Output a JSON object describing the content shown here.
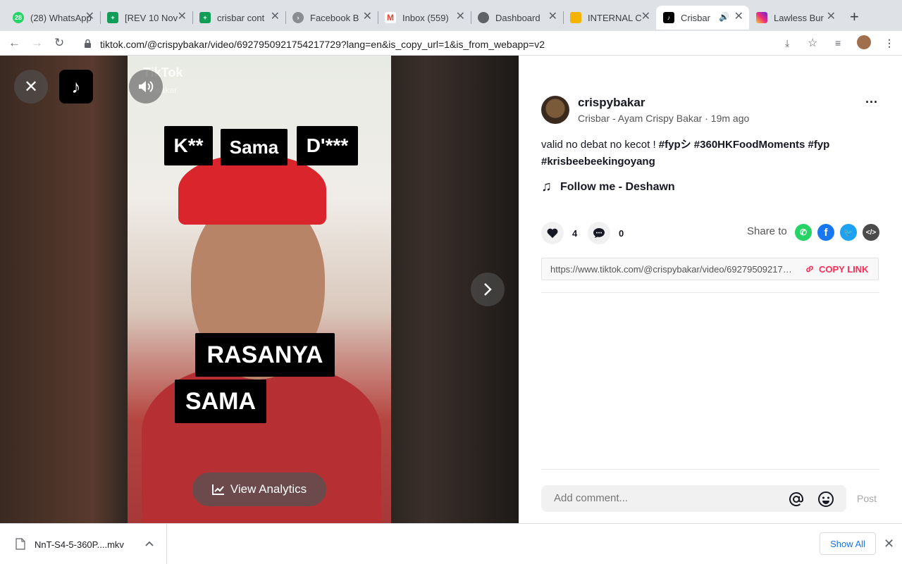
{
  "browser": {
    "tabs": [
      {
        "title": "(28) WhatsApp",
        "fav_color": "#25d366",
        "fav_text": "28",
        "icon": "whatsapp-icon"
      },
      {
        "title": "[REV 10 Nov",
        "fav_color": "#0f9d58",
        "fav_text": "+",
        "icon": "sheets-icon"
      },
      {
        "title": "crisbar cont",
        "fav_color": "#0f9d58",
        "fav_text": "+",
        "icon": "sheets-icon"
      },
      {
        "title": "Facebook B",
        "fav_color": "#8a8d91",
        "fav_text": ">",
        "icon": "facebook-business-icon"
      },
      {
        "title": "Inbox (559)",
        "fav_color": "#ea4335",
        "fav_text": "M",
        "icon": "gmail-icon"
      },
      {
        "title": "Dashboard",
        "fav_color": "#5f6368",
        "fav_text": "◍",
        "icon": "globe-icon"
      },
      {
        "title": "INTERNAL C",
        "fav_color": "#f4b400",
        "fav_text": "▭",
        "icon": "slides-icon"
      },
      {
        "title": "Crisbar",
        "fav_color": "#000000",
        "fav_text": "♪",
        "icon": "tiktok-icon"
      },
      {
        "title": "Lawless Bur",
        "fav_color": "#d62976",
        "fav_text": "◎",
        "icon": "instagram-icon"
      }
    ],
    "url": "tiktok.com/@crispybakar/video/6927950921754217729?lang=en&is_copy_url=1&is_from_webapp=v2"
  },
  "video": {
    "watermark": "TikTok",
    "watermark_user": "bakar",
    "captions": [
      "K**",
      "Sama",
      "D'***",
      "RASANYA",
      "SAMA"
    ],
    "analytics_label": "View Analytics"
  },
  "post": {
    "username": "crispybakar",
    "meta": "Crisbar - Ayam Crispy Bakar · 19m ago",
    "desc_text": "valid no debat no kecot ! ",
    "hashtags": [
      "#fypシ",
      "#360HKFoodMoments",
      "#fyp",
      "#krisbeebeekingoyang"
    ],
    "music": "Follow me - Deshawn",
    "likes": "4",
    "comments": "0",
    "share_label": "Share to",
    "link": "https://www.tiktok.com/@crispybakar/video/6927950921754217729",
    "copy_label": "COPY LINK",
    "comment_placeholder": "Add comment...",
    "post_label": "Post"
  },
  "download": {
    "filename": "NnT-S4-5-360P....mkv",
    "show_all": "Show All"
  },
  "colors": {
    "accent": "#fe2c55",
    "whatsapp": "#25d366",
    "facebook": "#1877f2",
    "twitter": "#1da1f2",
    "embed": "#4b4b4b"
  }
}
